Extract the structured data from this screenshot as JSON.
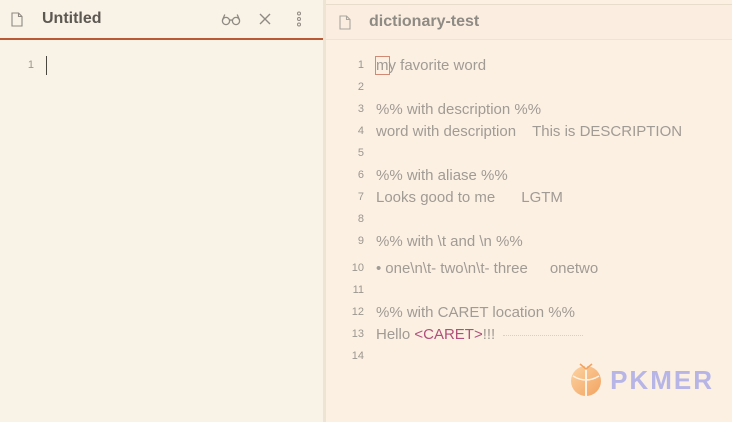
{
  "left_pane": {
    "tab_title": "Untitled",
    "actions": [
      "reading-view-icon",
      "close-icon",
      "more-options-icon"
    ],
    "lines": [
      {
        "num": "1",
        "text": ""
      }
    ]
  },
  "right_pane": {
    "tab_title": "dictionary-test",
    "lines": [
      {
        "num": "1",
        "first": "m",
        "rest": "y favorite word"
      },
      {
        "num": "2",
        "text": ""
      },
      {
        "num": "3",
        "text": "%% with description %%"
      },
      {
        "num": "4",
        "text": "word with description",
        "extra": "This is DESCRIPTION"
      },
      {
        "num": "5",
        "text": ""
      },
      {
        "num": "6",
        "text": "%% with aliase %%"
      },
      {
        "num": "7",
        "text": "Looks good to me",
        "extra": "LGTM"
      },
      {
        "num": "8",
        "text": ""
      },
      {
        "num": "9",
        "text": "%% with \\t and \\n %%"
      },
      {
        "num": "10",
        "bullet": "•",
        "text": "one\\n\\t- two\\n\\t- three",
        "extra": "onetwo"
      },
      {
        "num": "11",
        "text": ""
      },
      {
        "num": "12",
        "text": "%% with CARET location %%"
      },
      {
        "num": "13",
        "text": "Hello ",
        "tag": "<CARET>",
        "tail": "!!!"
      },
      {
        "num": "14",
        "text": ""
      }
    ]
  },
  "logo": {
    "text": "PKMER"
  },
  "colors": {
    "accent": "#b85a35",
    "caret_tag": "#b0507a",
    "logo": "#b6b5e6"
  }
}
